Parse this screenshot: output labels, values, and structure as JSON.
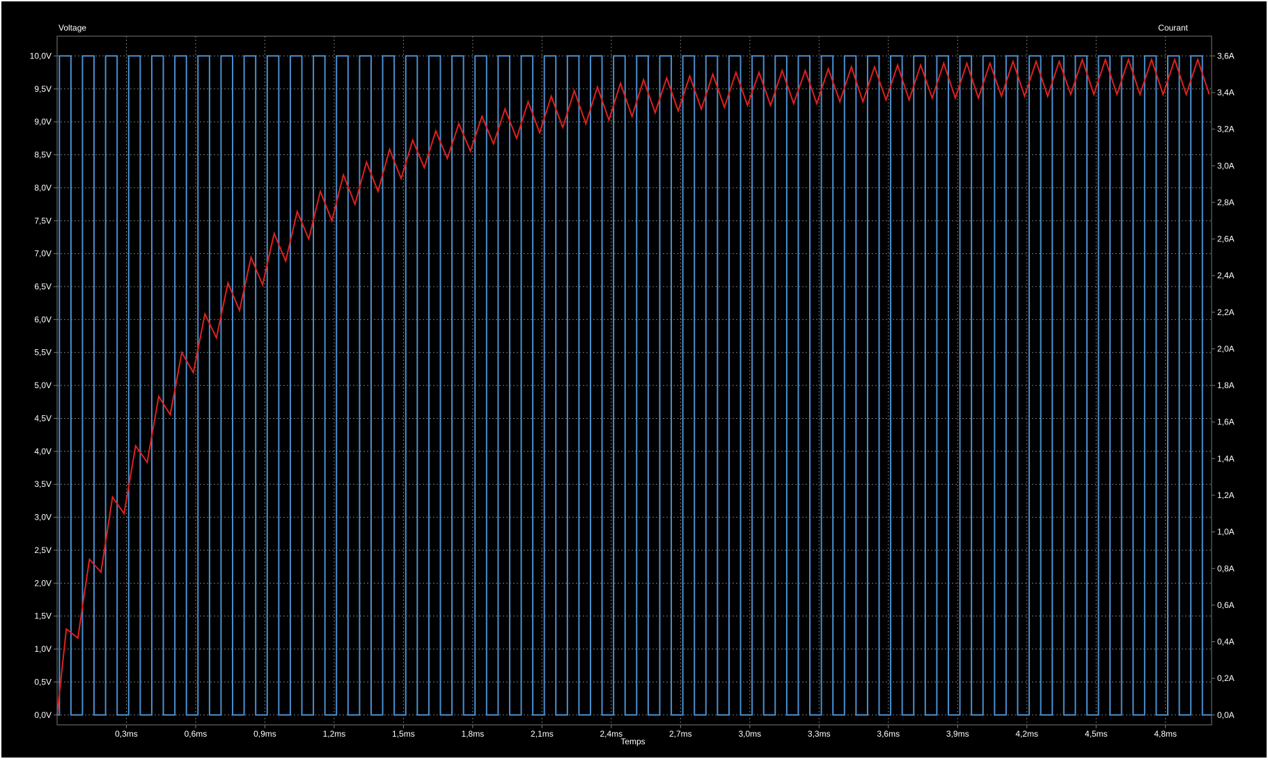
{
  "chart_data": {
    "type": "line",
    "xlabel": "Temps",
    "ylabel_left": "Voltage",
    "ylabel_right": "Courant",
    "x_unit": "ms",
    "x_range": [
      0,
      5.0
    ],
    "x_ticks": [
      "0,3ms",
      "0,6ms",
      "0,9ms",
      "1,2ms",
      "1,5ms",
      "1,8ms",
      "2,1ms",
      "2,4ms",
      "2,7ms",
      "3,0ms",
      "3,3ms",
      "3,6ms",
      "3,9ms",
      "4,2ms",
      "4,5ms",
      "4,8ms"
    ],
    "x_tick_values": [
      0.3,
      0.6,
      0.9,
      1.2,
      1.5,
      1.8,
      2.1,
      2.4,
      2.7,
      3.0,
      3.3,
      3.6,
      3.9,
      4.2,
      4.5,
      4.8
    ],
    "y_left_range": [
      -0.15,
      10.3
    ],
    "y_left_ticks": [
      "0,0V",
      "0,5V",
      "1,0V",
      "1,5V",
      "2,0V",
      "2,5V",
      "3,0V",
      "3,5V",
      "4,0V",
      "4,5V",
      "5,0V",
      "5,5V",
      "6,0V",
      "6,5V",
      "7,0V",
      "7,5V",
      "8,0V",
      "8,5V",
      "9,0V",
      "9,5V",
      "10,0V"
    ],
    "y_left_tick_values": [
      0,
      0.5,
      1,
      1.5,
      2,
      2.5,
      3,
      3.5,
      4,
      4.5,
      5,
      5.5,
      6,
      6.5,
      7,
      7.5,
      8,
      8.5,
      9,
      9.5,
      10
    ],
    "y_right_range": [
      -0.054,
      3.708
    ],
    "y_right_ticks": [
      "0,0A",
      "0,2A",
      "0,4A",
      "0,6A",
      "0,8A",
      "1,0A",
      "1,2A",
      "1,4A",
      "1,6A",
      "1,8A",
      "2,0A",
      "2,2A",
      "2,4A",
      "2,6A",
      "2,8A",
      "3,0A",
      "3,2A",
      "3,4A",
      "3,6A"
    ],
    "y_right_tick_values": [
      0,
      0.2,
      0.4,
      0.6,
      0.8,
      1.0,
      1.2,
      1.4,
      1.6,
      1.8,
      2.0,
      2.2,
      2.4,
      2.6,
      2.8,
      3.0,
      3.2,
      3.4,
      3.6
    ],
    "grid": true,
    "colors": {
      "background": "#000000",
      "grid": "#7a7a7a",
      "text": "#ffffff",
      "voltage": "#4a90d0",
      "current": "#e02020"
    },
    "series": [
      {
        "axis": "left",
        "kind": "square_wave",
        "low": 0,
        "high": 10,
        "period_ms": 0.1,
        "duty": 0.5,
        "first_rise_ms": 0.01,
        "t_end_ms": 5.0
      },
      {
        "axis": "right",
        "kind": "sawtooth",
        "peak_times_ms": [
          0.04,
          0.14,
          0.24,
          0.34,
          0.44,
          0.54,
          0.64,
          0.74,
          0.84,
          0.94,
          1.04,
          1.14,
          1.24,
          1.34,
          1.44,
          1.54,
          1.64,
          1.74,
          1.84,
          1.94,
          2.04,
          2.14,
          2.24,
          2.34,
          2.44,
          2.54,
          2.64,
          2.74,
          2.84,
          2.94,
          3.04,
          3.14,
          3.24,
          3.34,
          3.44,
          3.54,
          3.64,
          3.74,
          3.84,
          3.94,
          4.04,
          4.14,
          4.24,
          4.34,
          4.44,
          4.54,
          4.64,
          4.74,
          4.84,
          4.94
        ],
        "peaks_A": [
          0.47,
          0.85,
          1.19,
          1.47,
          1.74,
          1.98,
          2.19,
          2.36,
          2.5,
          2.63,
          2.75,
          2.86,
          2.95,
          3.02,
          3.09,
          3.14,
          3.19,
          3.23,
          3.27,
          3.31,
          3.35,
          3.38,
          3.41,
          3.43,
          3.45,
          3.47,
          3.48,
          3.49,
          3.5,
          3.51,
          3.51,
          3.52,
          3.52,
          3.53,
          3.54,
          3.54,
          3.55,
          3.55,
          3.56,
          3.56,
          3.56,
          3.57,
          3.57,
          3.57,
          3.58,
          3.58,
          3.58,
          3.58,
          3.58,
          3.58
        ],
        "valley_times_ms": [
          0.0,
          0.09,
          0.19,
          0.29,
          0.39,
          0.49,
          0.59,
          0.69,
          0.79,
          0.89,
          0.99,
          1.09,
          1.19,
          1.29,
          1.39,
          1.49,
          1.59,
          1.69,
          1.79,
          1.89,
          1.99,
          2.09,
          2.19,
          2.29,
          2.39,
          2.49,
          2.59,
          2.69,
          2.79,
          2.89,
          2.99,
          3.09,
          3.19,
          3.29,
          3.39,
          3.49,
          3.59,
          3.69,
          3.79,
          3.89,
          3.99,
          4.09,
          4.19,
          4.29,
          4.39,
          4.49,
          4.59,
          4.69,
          4.79,
          4.89,
          4.99
        ],
        "valleys_A": [
          0.0,
          0.42,
          0.78,
          1.1,
          1.38,
          1.64,
          1.87,
          2.06,
          2.21,
          2.35,
          2.48,
          2.6,
          2.7,
          2.79,
          2.86,
          2.93,
          2.99,
          3.04,
          3.08,
          3.12,
          3.15,
          3.18,
          3.21,
          3.23,
          3.25,
          3.27,
          3.29,
          3.3,
          3.31,
          3.32,
          3.33,
          3.33,
          3.34,
          3.34,
          3.35,
          3.35,
          3.36,
          3.36,
          3.37,
          3.37,
          3.37,
          3.38,
          3.38,
          3.38,
          3.39,
          3.39,
          3.39,
          3.39,
          3.39,
          3.39,
          3.39
        ]
      }
    ]
  }
}
